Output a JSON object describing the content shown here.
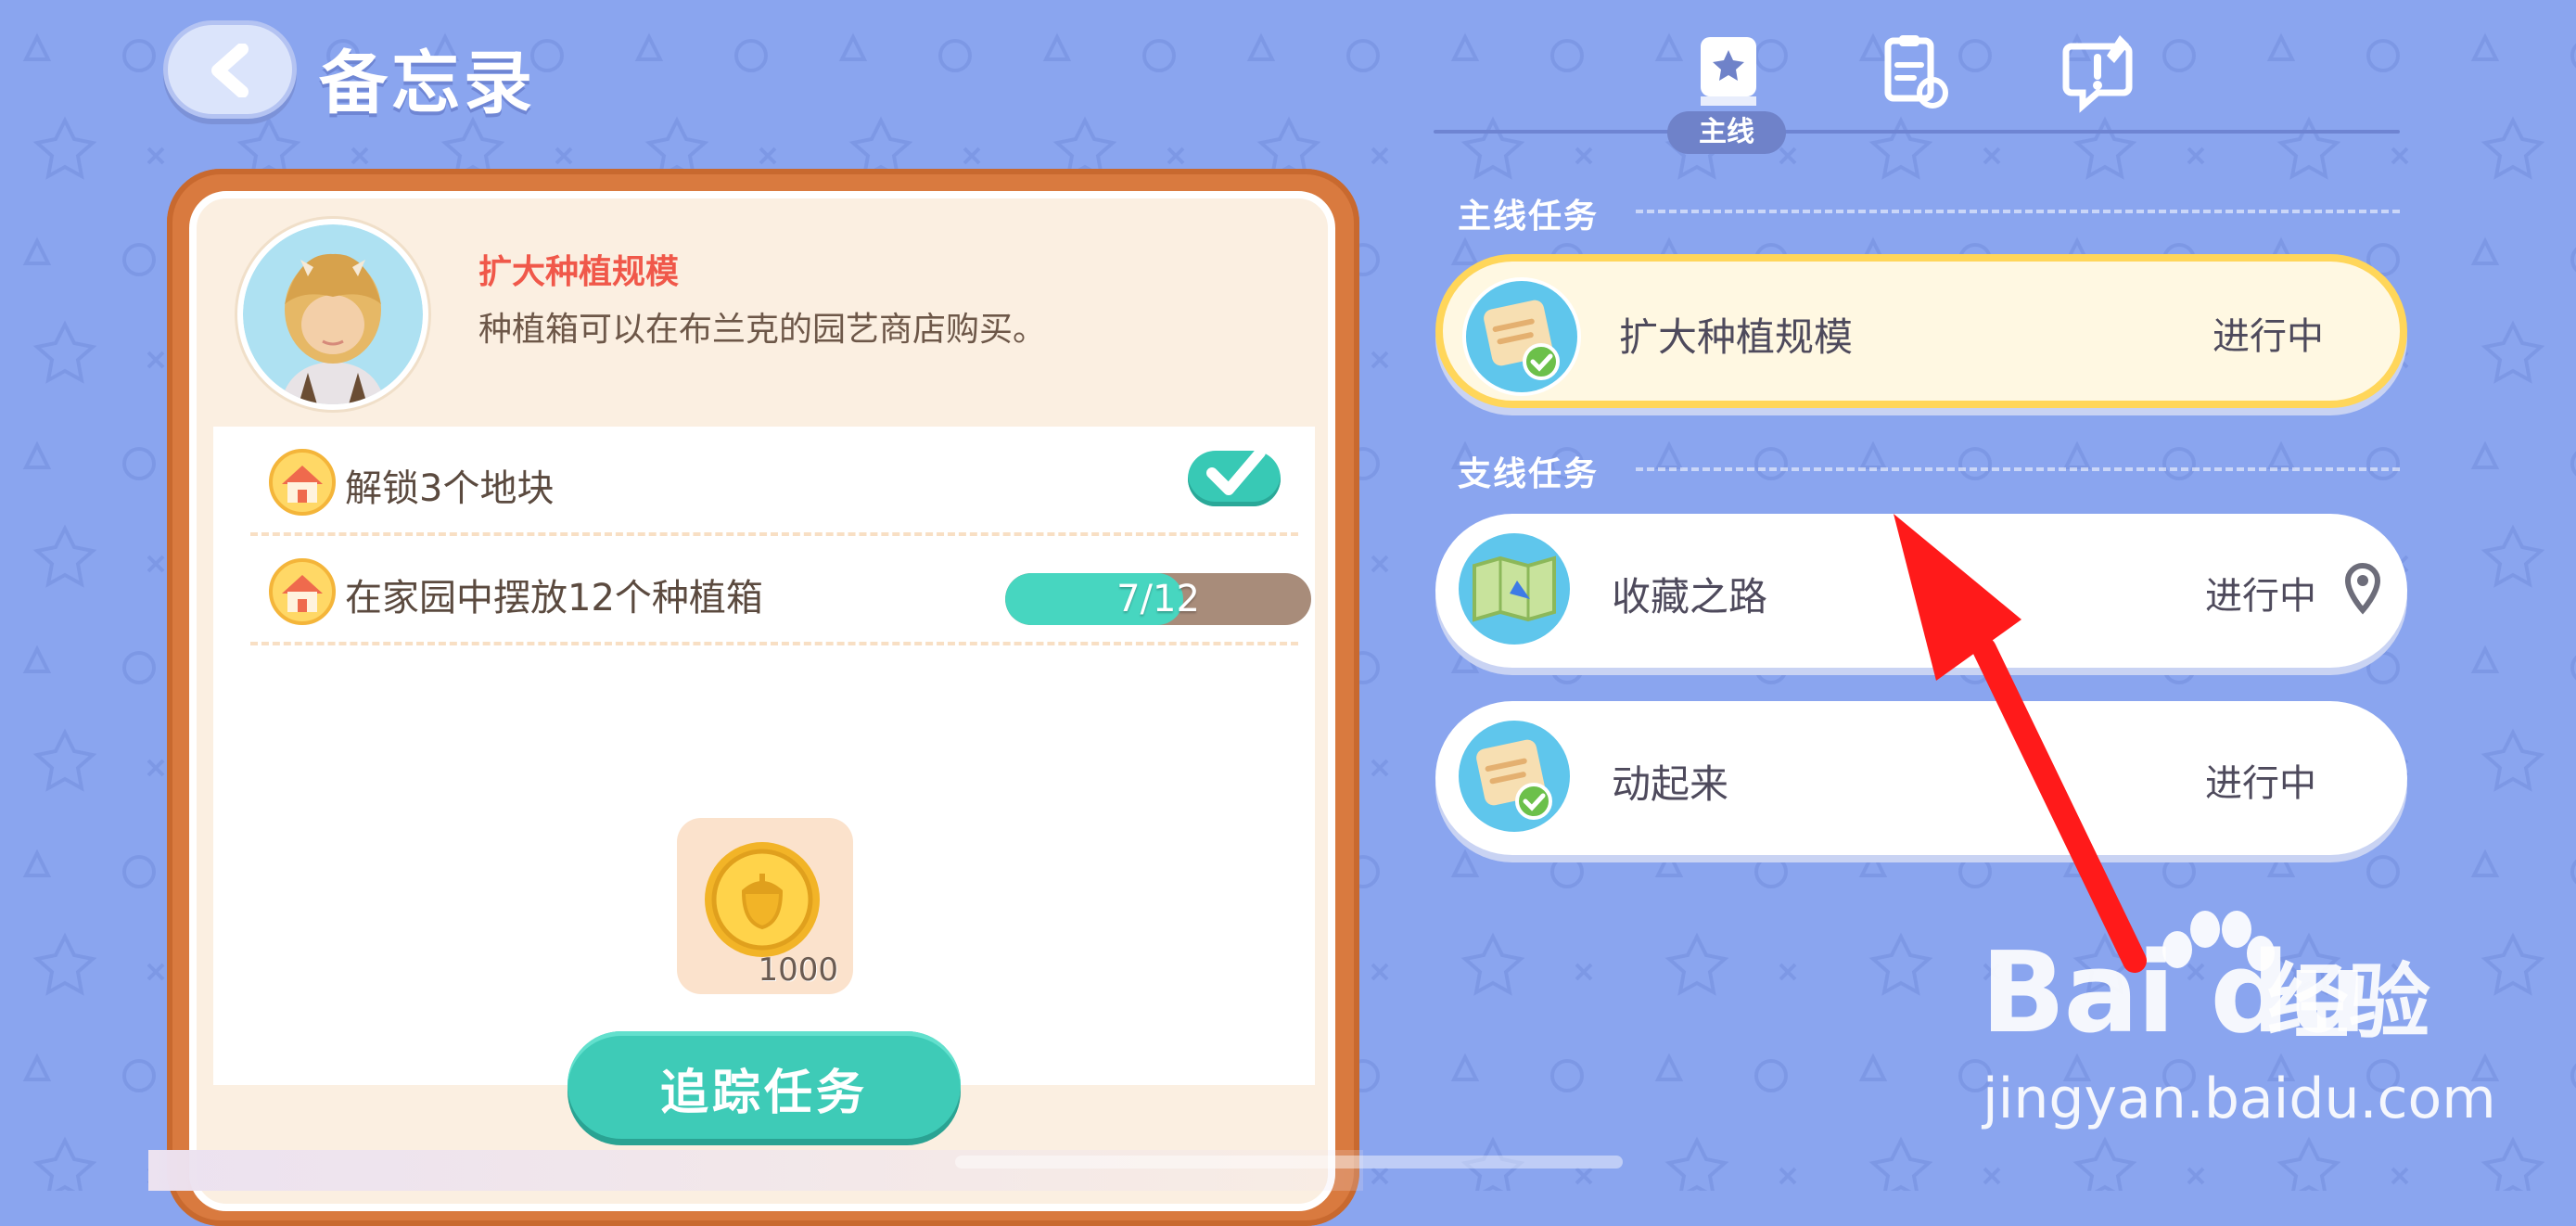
{
  "header": {
    "title": "备忘录",
    "back_icon": "chevron-left-icon"
  },
  "tabs": [
    {
      "label": "主线",
      "icon": "book-star-icon",
      "active": true
    },
    {
      "label": "",
      "icon": "clipboard-refresh-icon",
      "active": false
    },
    {
      "label": "",
      "icon": "bubble-exclamation-icon",
      "active": false
    }
  ],
  "detail": {
    "title": "扩大种植规模",
    "description": "种植箱可以在布兰克的园艺商店购买。",
    "objectives": [
      {
        "label": "解锁3个地块",
        "icon": "house-icon",
        "status": "done"
      },
      {
        "label": "在家园中摆放12个种植箱",
        "icon": "house-icon",
        "progress_text": "7/12",
        "progress": 0.583
      }
    ],
    "reward": {
      "icon": "acorn-coin-icon",
      "amount": "1000"
    },
    "track_button": "追踪任务"
  },
  "sections": {
    "main_header": "主线任务",
    "side_header": "支线任务"
  },
  "quests": {
    "main": [
      {
        "name": "扩大种植规模",
        "status": "进行中",
        "icon": "notepad-check-icon",
        "active": true
      }
    ],
    "side": [
      {
        "name": "收藏之路",
        "status": "进行中",
        "icon": "map-icon",
        "pin": true
      },
      {
        "name": "动起来",
        "status": "进行中",
        "icon": "notepad-check-icon",
        "pin": false
      }
    ]
  },
  "colors": {
    "background": "#8aa5ef",
    "panel_frame": "#d97a3f",
    "accent_teal": "#3ecbb7",
    "active_border": "#ffd65a",
    "title_red": "#f0584a",
    "annotation_arrow": "#ff1a1a"
  },
  "watermark": {
    "logo": "Bai du",
    "jing": "经验",
    "url": "jingyan.baidu.com"
  }
}
